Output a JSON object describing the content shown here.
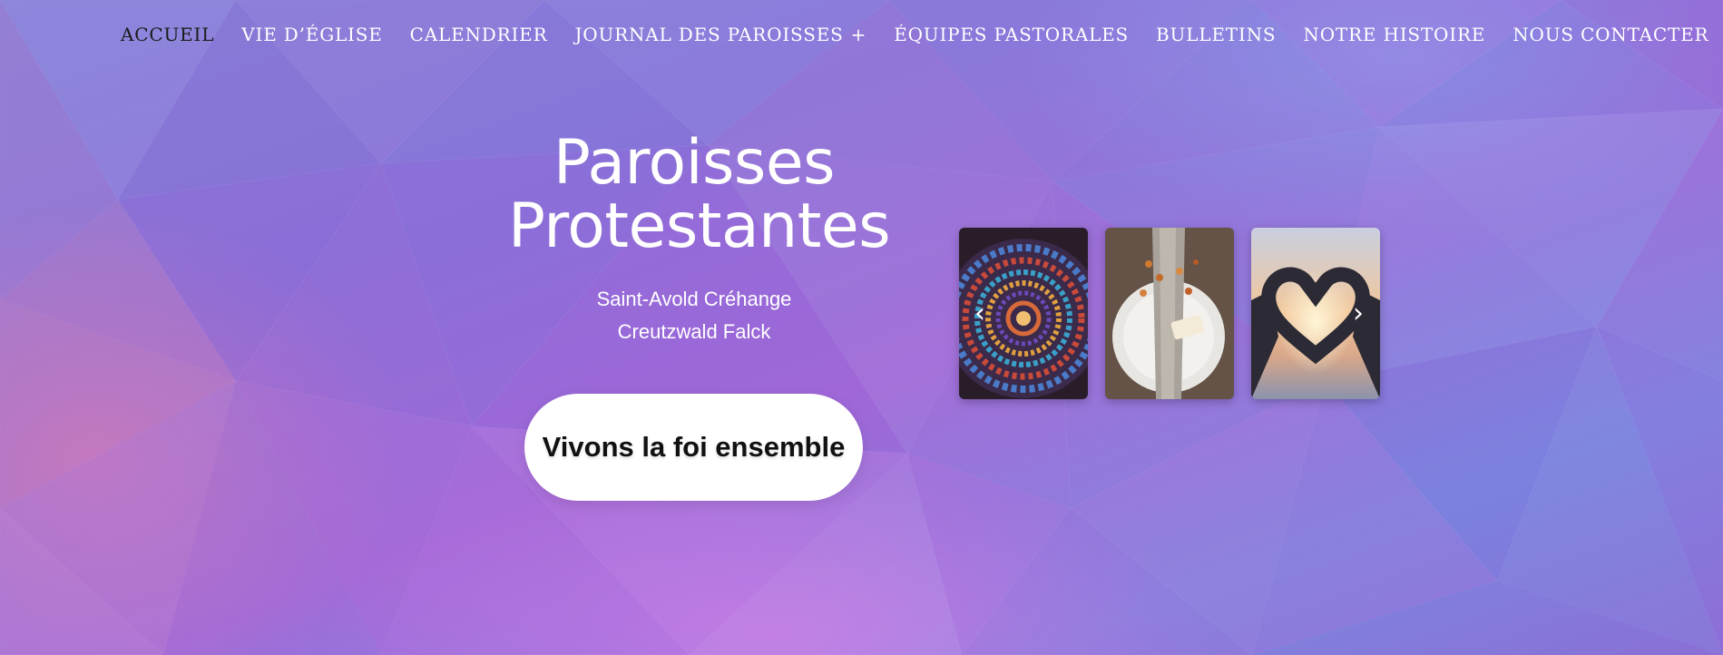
{
  "nav": {
    "items": [
      {
        "label": "ACCUEIL"
      },
      {
        "label": "VIE D’ÉGLISE"
      },
      {
        "label": "CALENDRIER"
      },
      {
        "label": "JOURNAL DES PAROISSES"
      },
      {
        "label": "ÉQUIPES PASTORALES"
      },
      {
        "label": "BULLETINS"
      },
      {
        "label": "NOTRE HISTOIRE"
      },
      {
        "label": "NOUS CONTACTER"
      }
    ],
    "submenu_indicator": "+"
  },
  "hero": {
    "title_line1": "Paroisses",
    "title_line2": "Protestantes",
    "subtitle_line1": "Saint-Avold Créhange",
    "subtitle_line2": "Creutzwald Falck",
    "cta_label": "Vivons la foi ensemble"
  },
  "carousel": {
    "prev_icon": "chevron-left-icon",
    "next_icon": "chevron-right-icon"
  },
  "colors": {
    "active_nav": "#1b1b1b",
    "nav_text": "#ffffff",
    "cta_bg": "#ffffff"
  }
}
